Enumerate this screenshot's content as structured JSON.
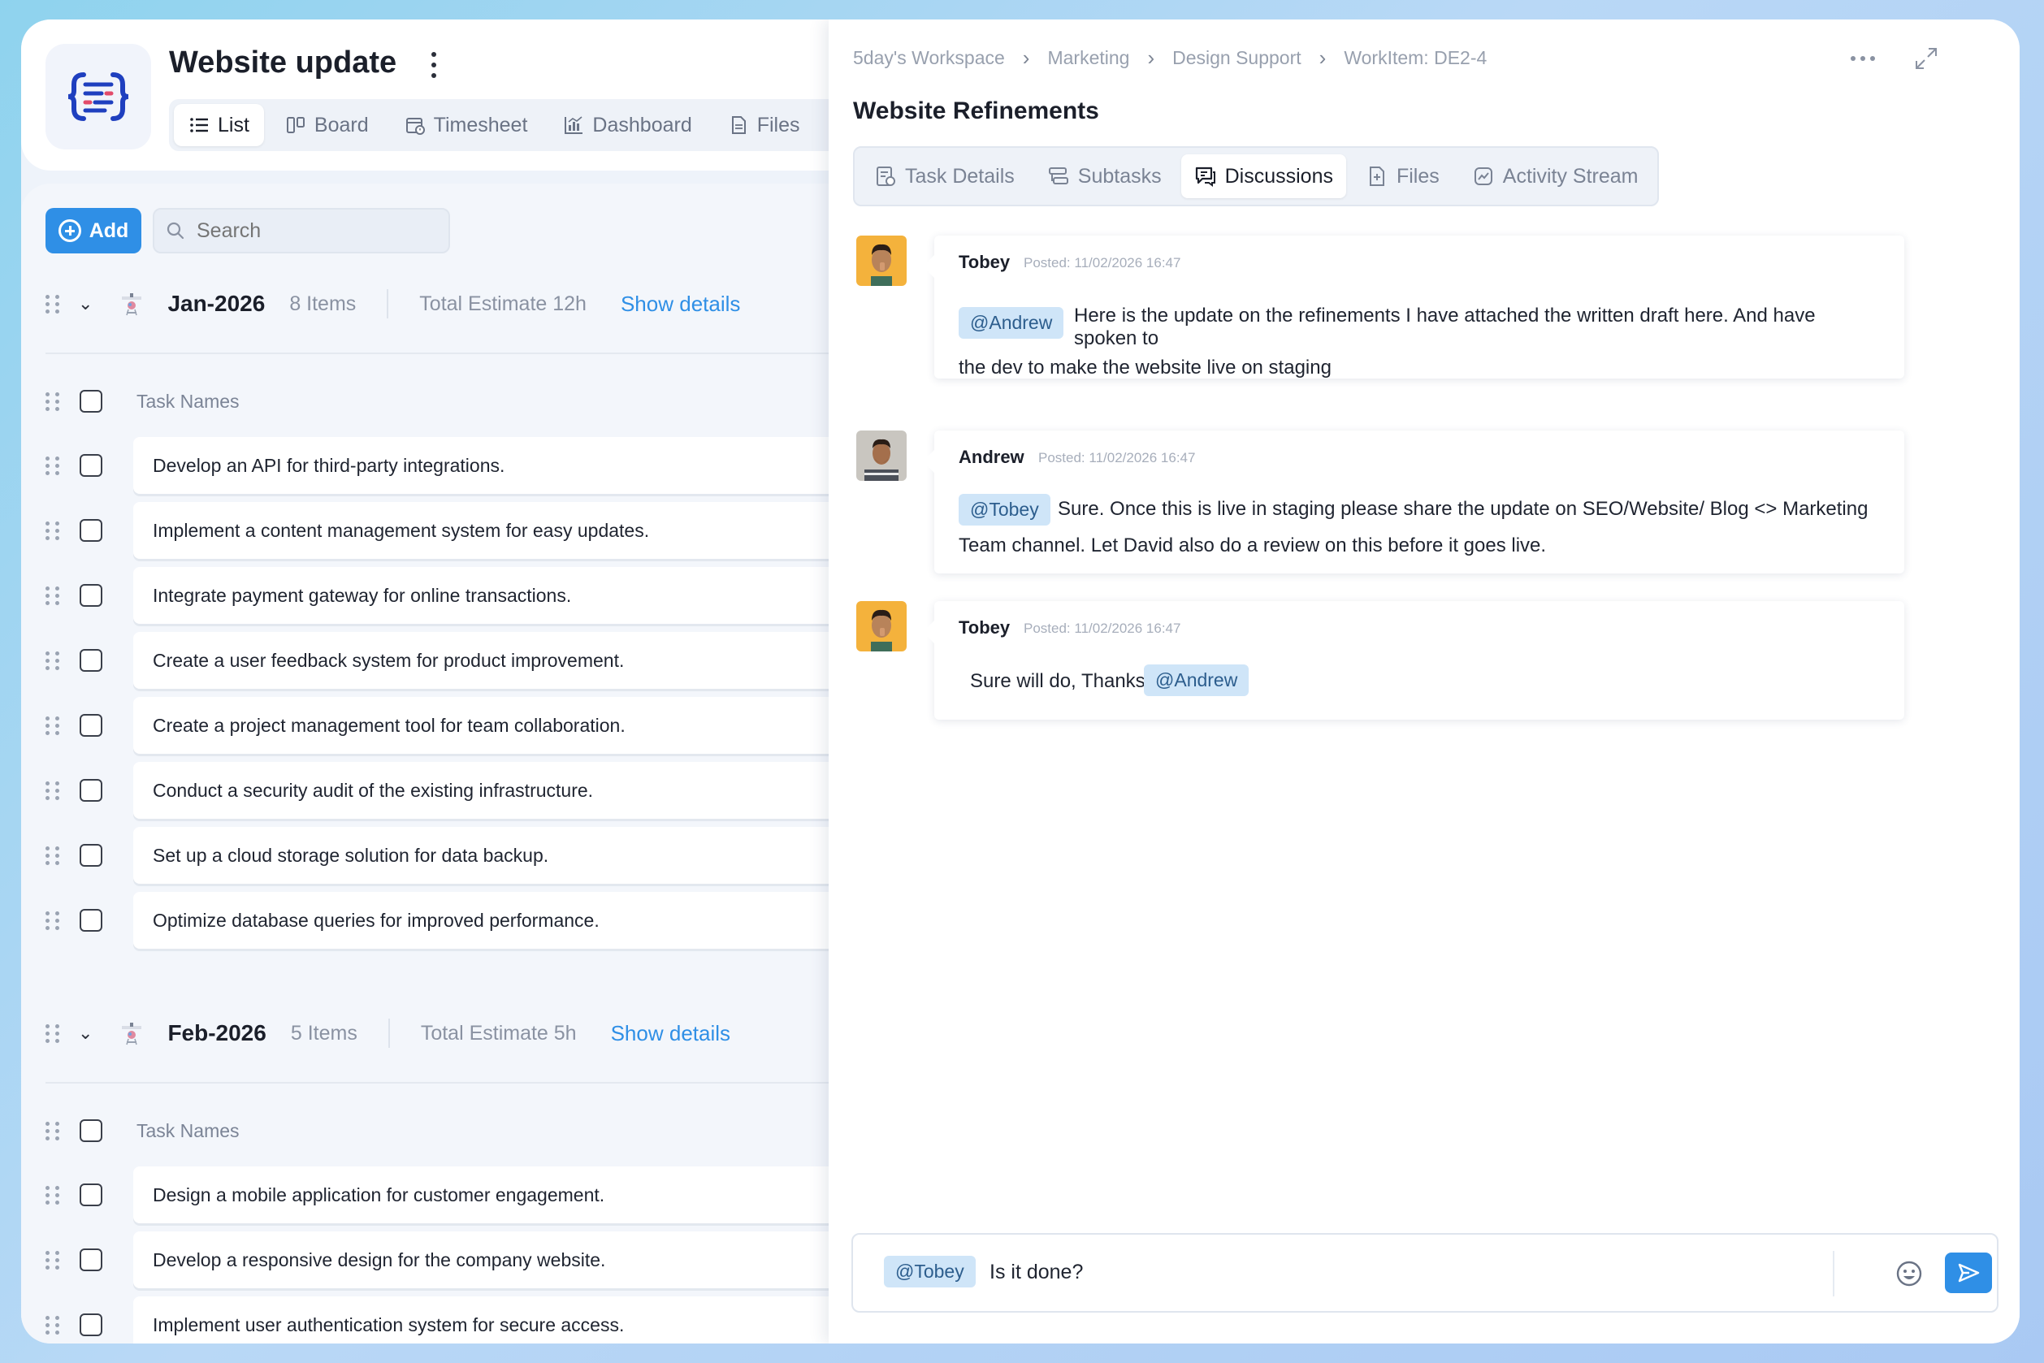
{
  "project": {
    "title": "Website update",
    "views": [
      {
        "label": "List",
        "active": true,
        "icon": "list-icon"
      },
      {
        "label": "Board",
        "active": false,
        "icon": "board-icon"
      },
      {
        "label": "Timesheet",
        "active": false,
        "icon": "timesheet-icon"
      },
      {
        "label": "Dashboard",
        "active": false,
        "icon": "dashboard-icon"
      },
      {
        "label": "Files",
        "active": false,
        "icon": "file-icon"
      }
    ]
  },
  "toolbar": {
    "add_label": "Add",
    "search_placeholder": "Search"
  },
  "groups": [
    {
      "month": "Jan-2026",
      "items_count": "8 Items",
      "estimate": "Total Estimate  12h",
      "show_details": "Show details",
      "column_label": "Task Names",
      "tasks": [
        "Develop an API for third-party integrations.",
        "Implement a content management system for easy updates.",
        "Integrate payment gateway for online transactions.",
        "Create a user feedback system for product improvement.",
        "Create a project management tool for team collaboration.",
        "Conduct a security audit of the existing infrastructure.",
        "Set up a cloud storage solution for data backup.",
        "Optimize database queries for improved performance."
      ]
    },
    {
      "month": "Feb-2026",
      "items_count": "5 Items",
      "estimate": "Total Estimate  5h",
      "show_details": "Show details",
      "column_label": "Task Names",
      "tasks": [
        "Design a mobile application for customer engagement.",
        "Develop a responsive design for the company website.",
        "Implement user authentication system for secure access."
      ]
    }
  ],
  "detail": {
    "breadcrumb": [
      "5day's Workspace",
      "Marketing",
      "Design Support",
      "WorkItem: DE2-4"
    ],
    "title": "Website Refinements",
    "tabs": [
      {
        "label": "Task Details",
        "active": false,
        "icon": "task-details-icon"
      },
      {
        "label": "Subtasks",
        "active": false,
        "icon": "subtasks-icon"
      },
      {
        "label": "Discussions",
        "active": true,
        "icon": "discussions-icon"
      },
      {
        "label": "Files",
        "active": false,
        "icon": "file-icon"
      },
      {
        "label": "Activity Stream",
        "active": false,
        "icon": "activity-icon"
      }
    ],
    "messages": [
      {
        "author": "Tobey",
        "posted": "Posted: 11/02/2026 16:47",
        "mention": "@Andrew",
        "text_line1": "Here is the update on the refinements I have attached the written draft here. And have",
        "text_line2": "spoken to",
        "text_line3": "the dev to make the website live on staging"
      },
      {
        "author": "Andrew",
        "posted": "Posted: 11/02/2026 16:47",
        "mention": "@Tobey",
        "text_line1": "Sure. Once this is live in staging please share the update on SEO/Website/ Blog <> Marketing",
        "text_line2": "Team channel.  Let David also do a review on this before it goes live."
      },
      {
        "author": "Tobey",
        "posted": "Posted: 11/02/2026 16:47",
        "text": "Sure will do, Thanks",
        "mention": "@Andrew"
      }
    ],
    "composer": {
      "mention": "@Tobey",
      "text": "Is it done?"
    }
  },
  "colors": {
    "accent": "#2f8fe6",
    "mention_bg": "#cfe5f8",
    "page_bg": "#eef3fa"
  }
}
